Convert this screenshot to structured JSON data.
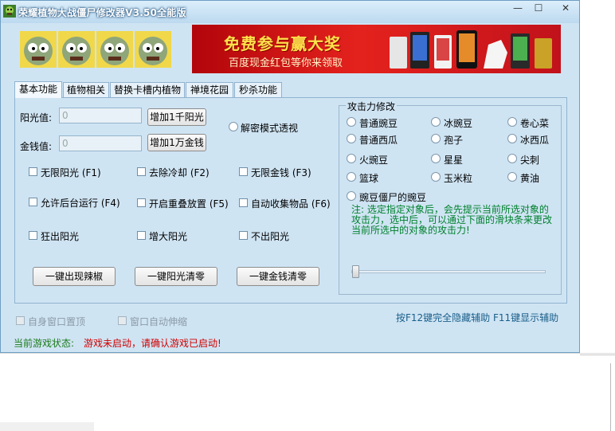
{
  "window": {
    "title": "荣耀植物大战僵尸修改器V3.50全能版",
    "controls": {
      "minimize": "—",
      "maximize": "☐",
      "close": "✕"
    }
  },
  "banner": {
    "headline": "免费参与赢大奖",
    "subline": "百度现金红包等你来领取"
  },
  "tabs": [
    {
      "label": "基本功能",
      "active": true
    },
    {
      "label": "植物相关",
      "active": false
    },
    {
      "label": "替换卡槽内植物",
      "active": false
    },
    {
      "label": "禅境花园",
      "active": false
    },
    {
      "label": "秒杀功能",
      "active": false
    }
  ],
  "basic": {
    "sun_label": "阳光值:",
    "sun_value": "0",
    "sun_button": "增加1千阳光",
    "money_label": "金钱值:",
    "money_value": "0",
    "money_button": "增加1万金钱",
    "radio_xray": "解密模式透视",
    "checkboxes": [
      "无限阳光 (F1)",
      "去除冷却 (F2)",
      "无限金钱 (F3)",
      "允许后台运行 (F4)",
      "开启重叠放置 (F5)",
      "自动收集物品 (F6)",
      "狂出阳光",
      "增大阳光",
      "不出阳光"
    ],
    "buttons": [
      "一键出现辣椒",
      "一键阳光清零",
      "一键金钱清零"
    ]
  },
  "attack": {
    "legend": "攻击力修改",
    "options": [
      "普通豌豆",
      "冰豌豆",
      "卷心菜",
      "普通西瓜",
      "孢子",
      "冰西瓜",
      "火豌豆",
      "星星",
      "尖刺",
      "篮球",
      "玉米粒",
      "黄油",
      "豌豆僵尸的豌豆"
    ],
    "note": "注: 选定指定对象后，会先提示当前所选对象的攻击力，选中后，可以通过下面的滑块条来更改当前所选中的对象的攻击力!"
  },
  "footer": {
    "topmost": "自身窗口置顶",
    "autoshrink": "窗口自动伸缩",
    "hotkey_hint": "按F12键完全隐藏辅助 F11键显示辅助",
    "status_title": "当前游戏状态:",
    "status_message": "游戏未启动，请确认游戏已启动!"
  },
  "colors": {
    "window_bg": "#cfe4f3",
    "status_ok": "#1a7a1a",
    "status_err": "#d00000",
    "note": "#00802d",
    "hotkey": "#1a5f8a"
  }
}
